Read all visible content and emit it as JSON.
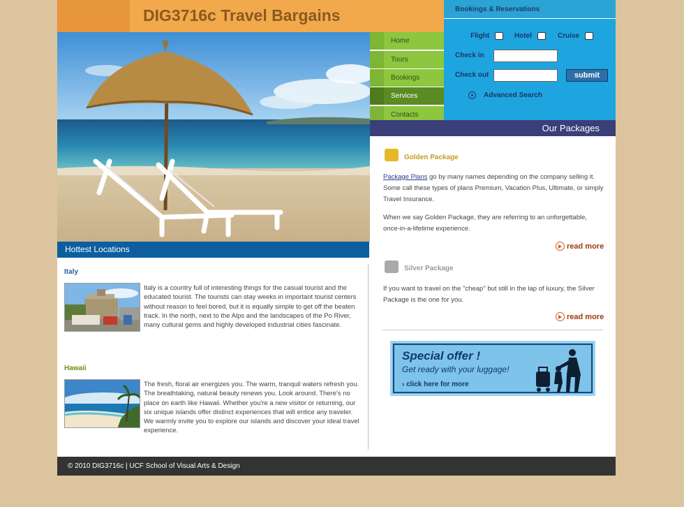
{
  "header": {
    "title": "DIG3716c Travel Bargains"
  },
  "nav": {
    "items": [
      {
        "label": "Home",
        "active": false
      },
      {
        "label": "Tours",
        "active": false
      },
      {
        "label": "Bookings",
        "active": false
      },
      {
        "label": "Services",
        "active": true
      },
      {
        "label": "Contacts",
        "active": false
      }
    ]
  },
  "bookings": {
    "heading": "Bookings & Reservations",
    "flight_label": "Flight",
    "hotel_label": "Hotel",
    "cruise_label": "Cruise",
    "checkin_label": "Check in",
    "checkout_label": "Check out",
    "checkin_value": "",
    "checkout_value": "",
    "submit_label": "submit",
    "advanced_label": "Advanced Search"
  },
  "packages": {
    "heading": "Our Packages",
    "golden": {
      "title": "Golden Package",
      "link": "Package Plans",
      "text1": " go by many names depending on the company selling it. Some call these types of plans Premium, Vacation Plus, Ultimate, or simply Travel Insurance.",
      "text2": "When we say Golden Package, they are referring to an unforgettable, once-in-a-lifetime experience.",
      "read_more": "read more"
    },
    "silver": {
      "title": "Silver Package",
      "text": "If you want to travel on the \"cheap\" but still in the lap of luxury, the Silver Package is the one for you.",
      "read_more": "read more"
    }
  },
  "offer": {
    "title": "Special offer !",
    "subtitle": "Get ready with your luggage!",
    "link": "click here for more"
  },
  "hottest": {
    "heading": "Hottest Locations",
    "italy": {
      "title": "Italy",
      "text": "Italy is a country full of interesting things for the casual tourist and the educated tourist. The tourists can stay weeks in important tourist centers without reason to feel bored, but it is equally simple to get off the beaten track. In the north, next to the Alps and the landscapes of the Po River, many cultural gems and highly developed industrial cities fascinate."
    },
    "hawaii": {
      "title": "Hawaii",
      "text": "The fresh, floral air energizes you. The warm, tranquil waters refresh you. The breathtaking, natural beauty renews you. Look around. There's no place on earth like Hawaii. Whether you're a new visitor or returning, our six unique islands offer distinct experiences that will entice any traveler. We warmly invite you to explore our islands and discover your ideal travel experience."
    }
  },
  "footer": {
    "text": "© 2010 DIG3716c | UCF School of Visual Arts & Design"
  },
  "colors": {
    "background": "#dcc49e",
    "header": "#f2a94b",
    "nav": "#8dc63f",
    "booking": "#1ea5e0",
    "packages_head": "#3a3e79",
    "hottest_head": "#0c5e9f",
    "golden": "#c49a1d",
    "silver": "#9a9a9a",
    "italy": "#2a5b9a",
    "hawaii": "#6b8f1a",
    "footer": "#333333"
  }
}
